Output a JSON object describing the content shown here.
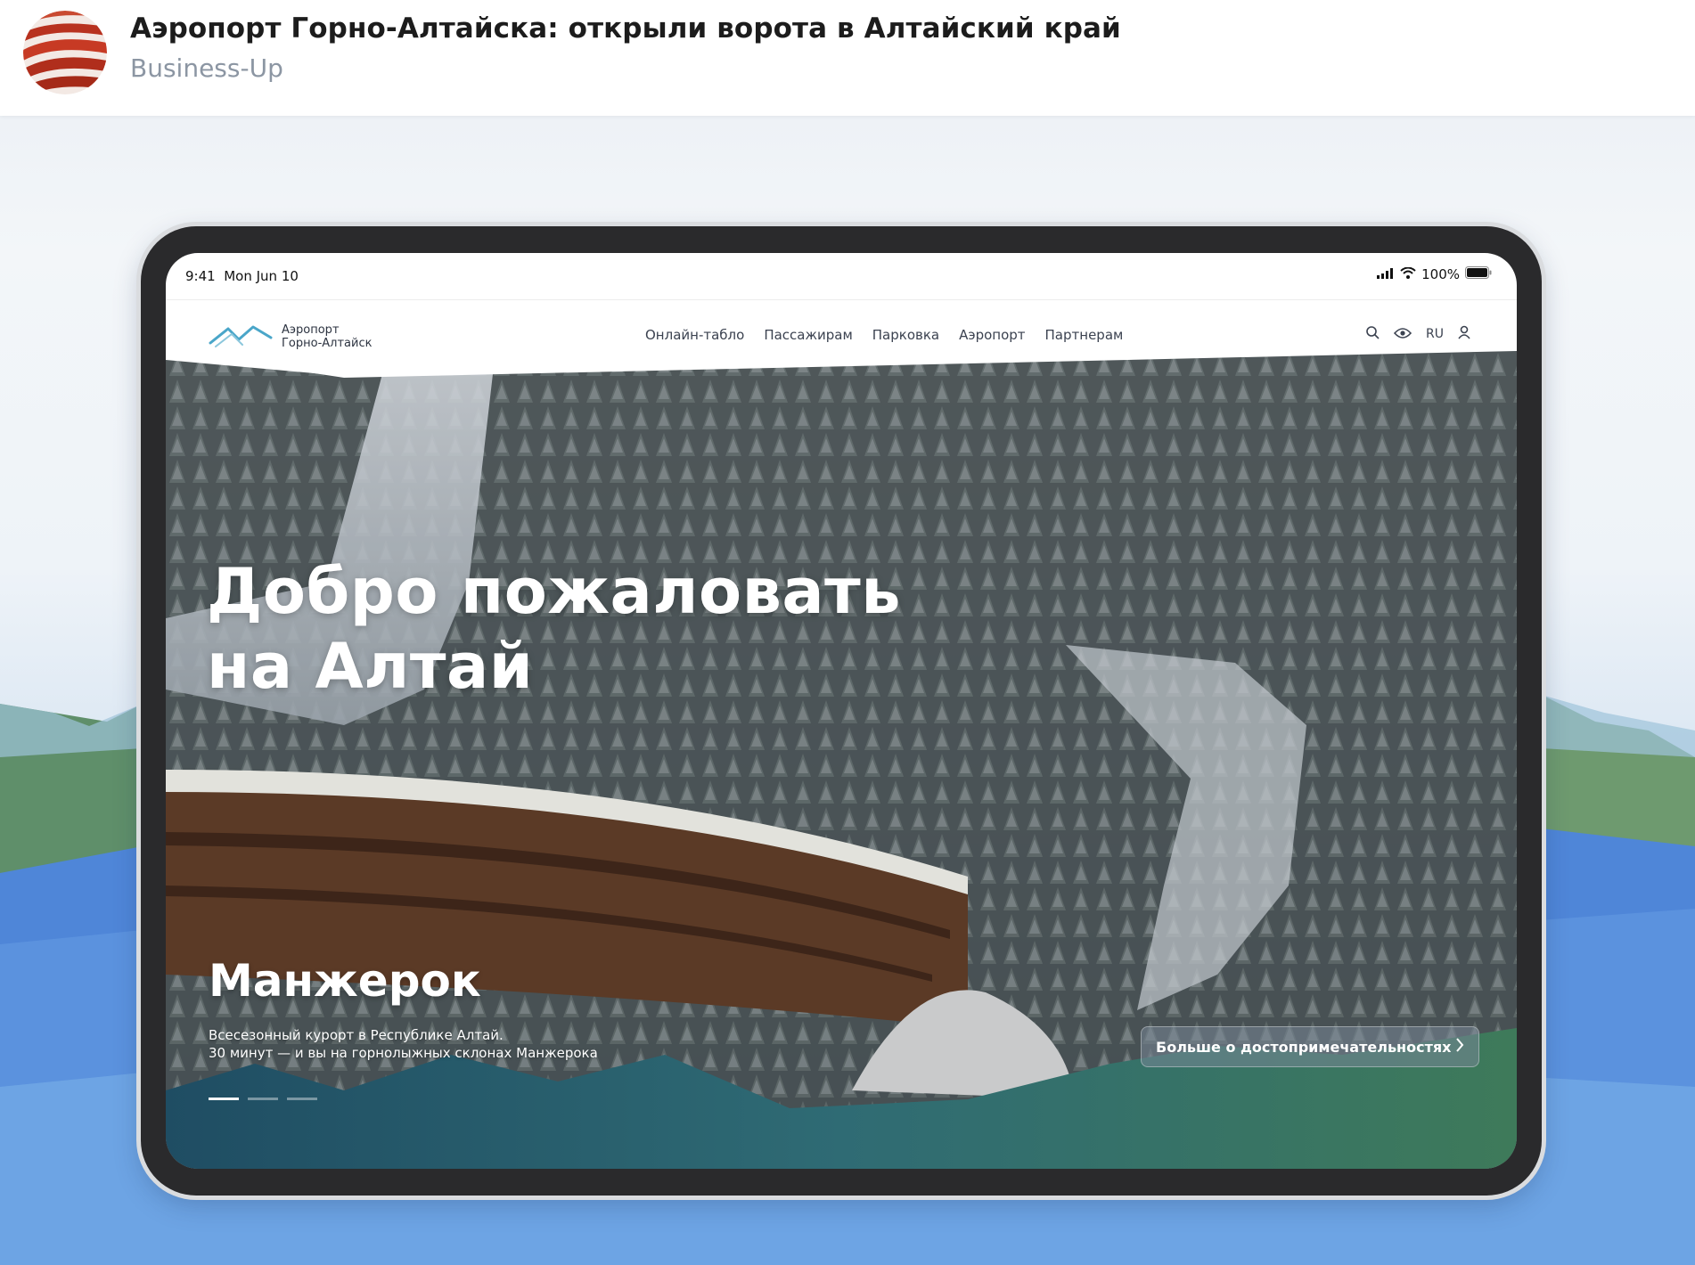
{
  "post": {
    "title": "Аэропорт Горно-Алтайска: открыли ворота в Алтайский край",
    "source": "Business-Up",
    "avatar_icon": "business-up-logo"
  },
  "device": {
    "status_time": "9:41",
    "status_date": "Mon Jun 10",
    "battery": "100%",
    "icons": [
      "signal-icon",
      "wifi-icon",
      "battery-icon"
    ]
  },
  "site": {
    "logo_line1": "Аэропорт",
    "logo_line2": "Горно-Алтайск",
    "nav": [
      "Онлайн-табло",
      "Пассажирам",
      "Парковка",
      "Аэропорт",
      "Партнерам"
    ],
    "lang": "RU",
    "tools": [
      "search-icon",
      "eye-icon",
      "user-icon"
    ]
  },
  "hero": {
    "title": "Добро пожаловать\nна Алтай",
    "slide_title": "Манжерок",
    "slide_desc": "Всесезонный курорт в Республике Алтай.\n30 минут — и вы на горнолыжных склонах Манжерока",
    "more_button": "Больше о достопримечательностях",
    "slides_total": 3,
    "active_slide": 1
  },
  "colors": {
    "brand_accent": "#4aa6c9",
    "background_blue": "#7aa9e2",
    "avatar_red": "#c0392b"
  }
}
